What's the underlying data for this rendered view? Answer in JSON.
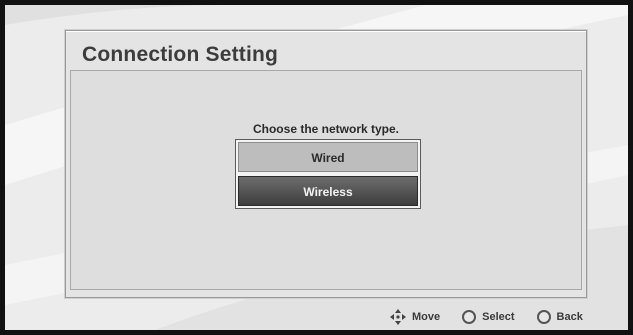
{
  "dialog": {
    "title": "Connection Setting",
    "prompt": "Choose the network type.",
    "options": [
      {
        "label": "Wired",
        "selected": false
      },
      {
        "label": "Wireless",
        "selected": true
      }
    ]
  },
  "footer": {
    "move_label": "Move",
    "move_icon": "dpad-arrows-icon",
    "select_label": "Select",
    "select_icon": "circle-button-icon",
    "back_label": "Back",
    "back_icon": "circle-button-icon"
  },
  "colors": {
    "background": "#ececec",
    "selected_option": "#4a4a4a",
    "unselected_option": "#bdbdbd"
  }
}
